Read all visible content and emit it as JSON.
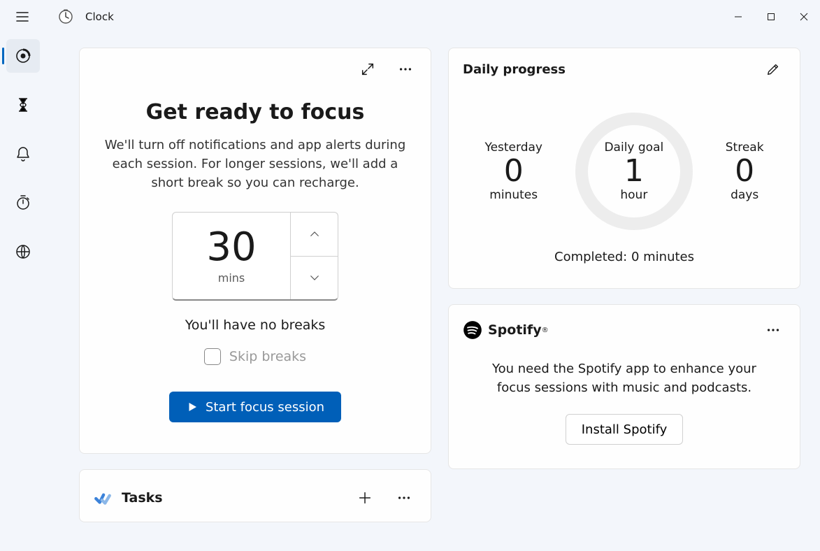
{
  "app": {
    "title": "Clock"
  },
  "window_controls": {
    "minimize": "minimize",
    "maximize": "maximize",
    "close": "close"
  },
  "sidebar": {
    "items": [
      {
        "name": "focus-sessions",
        "selected": true
      },
      {
        "name": "timer"
      },
      {
        "name": "alarm"
      },
      {
        "name": "stopwatch"
      },
      {
        "name": "world-clock"
      }
    ]
  },
  "focus": {
    "heading": "Get ready to focus",
    "description": "We'll turn off notifications and app alerts during each session. For longer sessions, we'll add a short break so you can recharge.",
    "duration_value": "30",
    "duration_unit": "mins",
    "breaks_text": "You'll have no breaks",
    "skip_label": "Skip breaks",
    "start_label": "Start focus session"
  },
  "tasks": {
    "title": "Tasks"
  },
  "progress": {
    "title": "Daily progress",
    "yesterday": {
      "label": "Yesterday",
      "value": "0",
      "unit": "minutes"
    },
    "goal": {
      "label": "Daily goal",
      "value": "1",
      "unit": "hour"
    },
    "streak": {
      "label": "Streak",
      "value": "0",
      "unit": "days"
    },
    "completed": "Completed: 0 minutes"
  },
  "spotify": {
    "brand": "Spotify",
    "message": "You need the Spotify app to enhance your focus sessions with music and podcasts.",
    "install_label": "Install Spotify"
  }
}
